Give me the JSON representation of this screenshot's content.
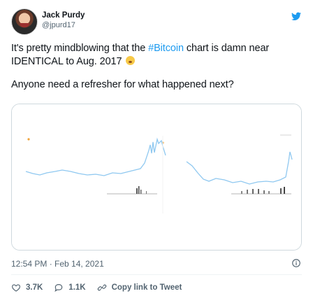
{
  "author": {
    "display_name": "Jack Purdy",
    "handle": "@jpurd17"
  },
  "tweet": {
    "text_before_hashtag": "It's pretty mindblowing that the ",
    "hashtag": "#Bitcoin",
    "text_after_hashtag": " chart is damn near IDENTICAL to Aug. 2017 ",
    "second_line": "Anyone need a refresher for what happened next?",
    "timestamp": "12:54 PM · Feb 14, 2021"
  },
  "actions": {
    "likes": "3.7K",
    "replies": "1.1K",
    "copy_link": "Copy link to Tweet"
  },
  "icons": {
    "brand": "twitter-bird-icon",
    "info": "info-icon",
    "like": "heart-icon",
    "reply": "reply-bubble-icon",
    "link": "link-icon"
  },
  "colors": {
    "twitter_blue": "#1d9bf0",
    "secondary_text": "#536471",
    "chart_line": "#8fc8f0"
  }
}
